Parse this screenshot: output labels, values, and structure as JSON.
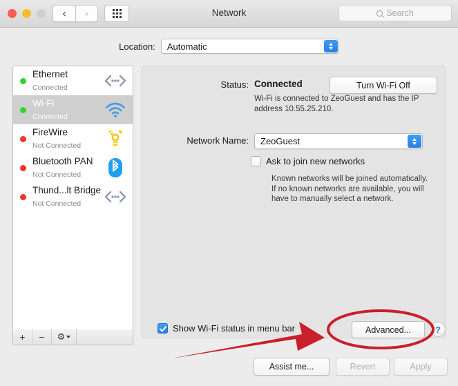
{
  "window": {
    "title": "Network",
    "traffic_lights": [
      "close",
      "minimize",
      "zoom"
    ],
    "back_label": "‹",
    "forward_label": "›",
    "show_all_label": "Show All",
    "search_placeholder": "Search"
  },
  "location": {
    "label": "Location:",
    "value": "Automatic"
  },
  "sidebar": {
    "interfaces": [
      {
        "name": "Ethernet",
        "status": "Connected",
        "dot": "green",
        "icon": "ethernet-icon"
      },
      {
        "name": "Wi-Fi",
        "status": "Connected",
        "dot": "green",
        "icon": "wifi-icon",
        "selected": true
      },
      {
        "name": "FireWire",
        "status": "Not Connected",
        "dot": "red",
        "icon": "firewire-icon"
      },
      {
        "name": "Bluetooth PAN",
        "status": "Not Connected",
        "dot": "red",
        "icon": "bluetooth-icon"
      },
      {
        "name": "Thund...lt Bridge",
        "status": "Not Connected",
        "dot": "red",
        "icon": "ethernet-icon"
      }
    ],
    "toolbar": {
      "add_label": "+",
      "remove_label": "−",
      "action_label": "gear-icon"
    }
  },
  "main": {
    "status_label": "Status:",
    "status_value": "Connected",
    "status_description": "Wi-Fi is connected to ZeoGuest and has the IP address 10.55.25.210.",
    "wifi_toggle_label": "Turn Wi-Fi Off",
    "network_name_label": "Network Name:",
    "network_name_value": "ZeoGuest",
    "ask_to_join_label": "Ask to join new networks",
    "ask_to_join_checked": false,
    "ask_to_join_description": "Known networks will be joined automatically. If no known networks are available, you will have to manually select a network.",
    "show_status_label": "Show Wi-Fi status in menu bar",
    "show_status_checked": true,
    "advanced_label": "Advanced...",
    "help_label": "?"
  },
  "footer": {
    "assist_label": "Assist me...",
    "revert_label": "Revert",
    "revert_disabled": true,
    "apply_label": "Apply",
    "apply_disabled": true
  },
  "annotation": {
    "arrow_color": "#c9202c",
    "ellipse_color": "#c9202c",
    "target": "Advanced..."
  },
  "colors": {
    "accent_blue": "#2b7fe0",
    "connected_green": "#30d630",
    "disconnected_red": "#f2342a",
    "annotation_red": "#c9202c",
    "selected_row": "#cfcfcf"
  }
}
